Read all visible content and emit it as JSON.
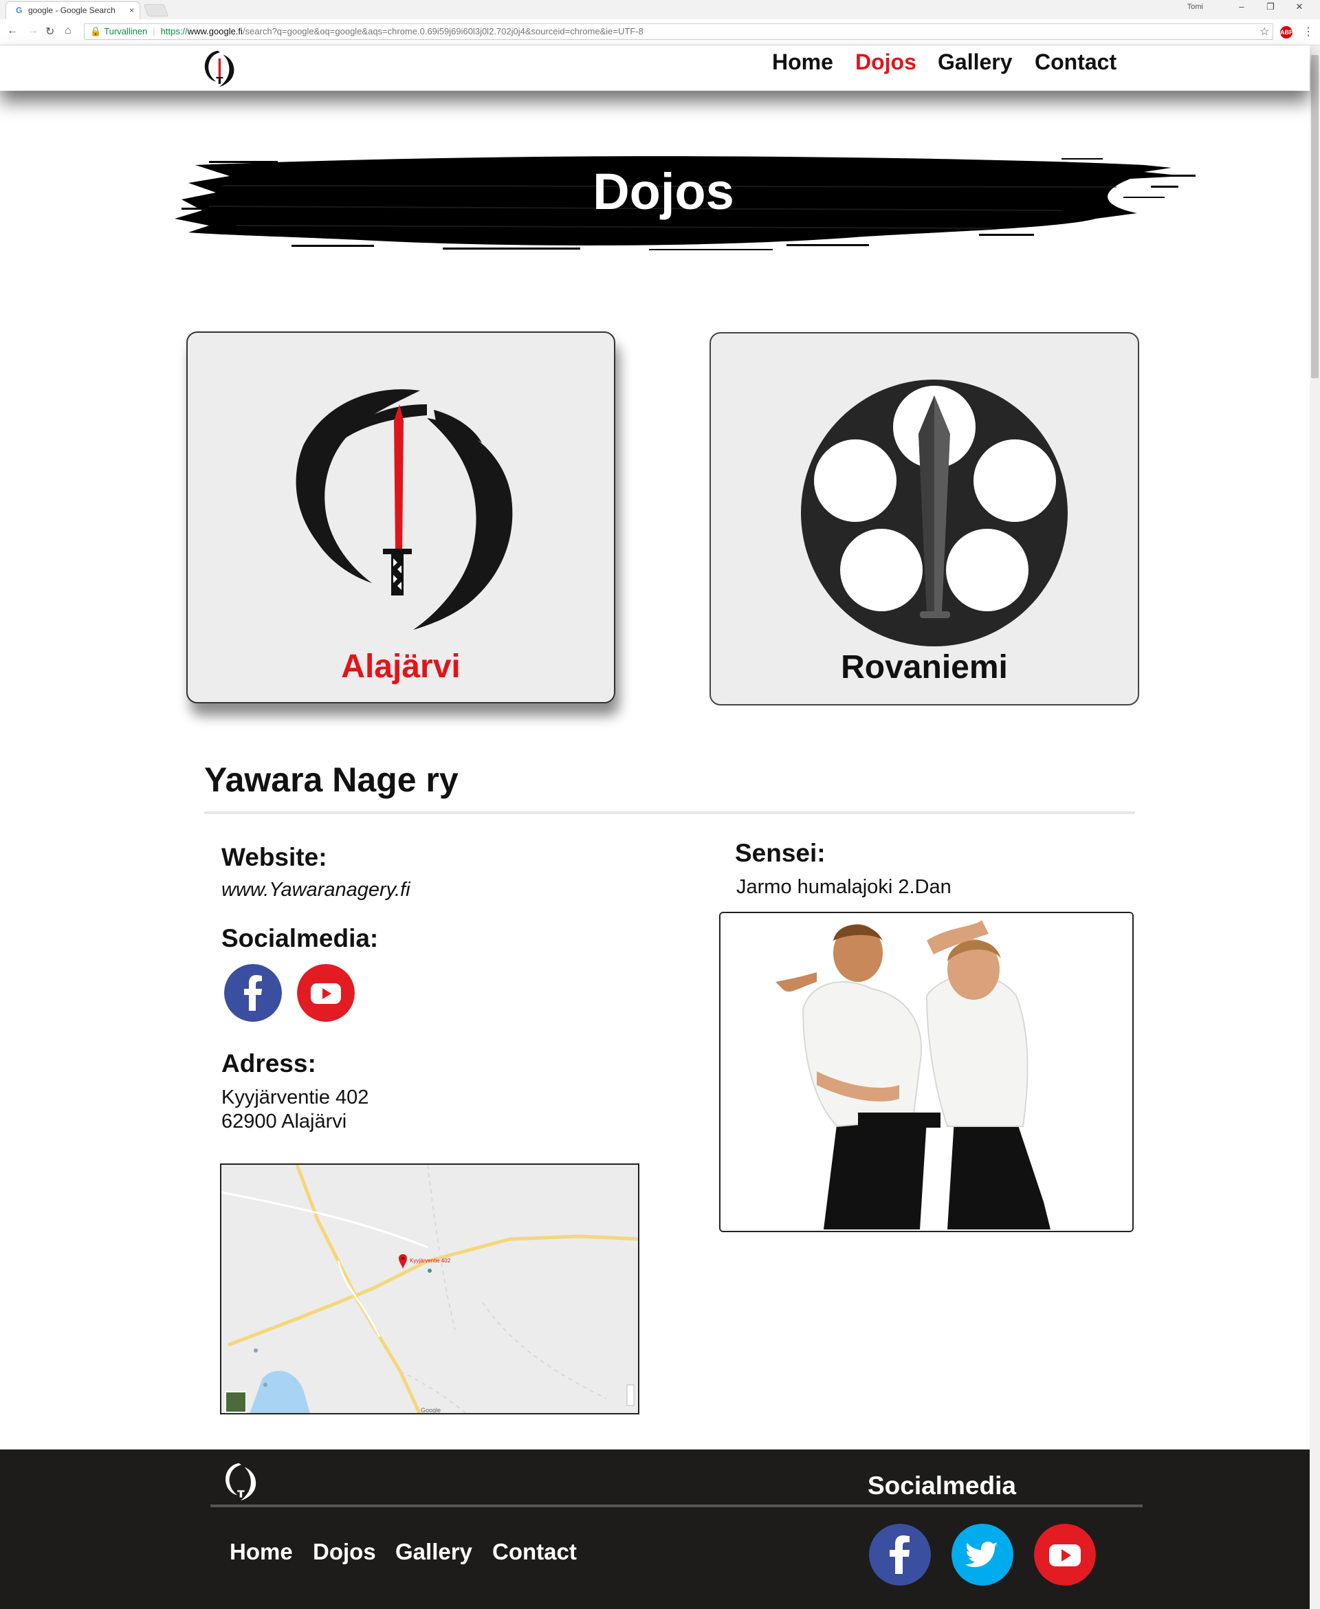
{
  "browser": {
    "tab_title": "google - Google Search",
    "tab_favicon": "G",
    "tab_close": "×",
    "user": "Tomi",
    "window_controls": {
      "minimize": "–",
      "restore": "❐",
      "close": "✕"
    },
    "nav": {
      "back": "←",
      "forward": "→",
      "reload": "↻",
      "home": "⌂"
    },
    "secure_label": "Turvallinen",
    "url_scheme": "https://",
    "url_domain": "www.google.fi",
    "url_path": "/search?q=google&oq=google&aqs=chrome.0.69i59j69i60l3j0l2.702j0j4&sourceid=chrome&ie=UTF-8",
    "bookmark_icon": "☆",
    "extension_badge": "ABP",
    "menu_icon": "⋮"
  },
  "nav": {
    "home": "Home",
    "dojos": "Dojos",
    "gallery": "Gallery",
    "contact": "Contact"
  },
  "banner_title": "Dojos",
  "cards": [
    {
      "label": "Alajärvi",
      "color": "#e0151b",
      "icon": "katana-logo-icon"
    },
    {
      "label": "Rovaniemi",
      "color": "#111111",
      "icon": "rovaniemi-emblem-icon"
    }
  ],
  "dojo": {
    "name": "Yawara Nage ry",
    "website_heading": "Website:",
    "website": "www.Yawaranagery.fi",
    "social_heading": "Socialmedia:",
    "address_heading": "Adress:",
    "address_line1": "Kyyjärventie 402",
    "address_line2": "62900 Alajärvi",
    "sensei_heading": "Sensei:",
    "sensei": "Jarmo humalajoki  2.Dan"
  },
  "map": {
    "pin_label": "Kyyjärventie 402",
    "attribution": "Google"
  },
  "footer": {
    "social_heading": "Socialmedia",
    "nav": {
      "home": "Home",
      "dojos": "Dojos",
      "gallery": "Gallery",
      "contact": "Contact"
    }
  },
  "colors": {
    "accent": "#e0151b",
    "facebook": "#3b4fa0",
    "twitter": "#00aced",
    "youtube": "#e31b23",
    "footer_bg": "#1d1c1b"
  }
}
